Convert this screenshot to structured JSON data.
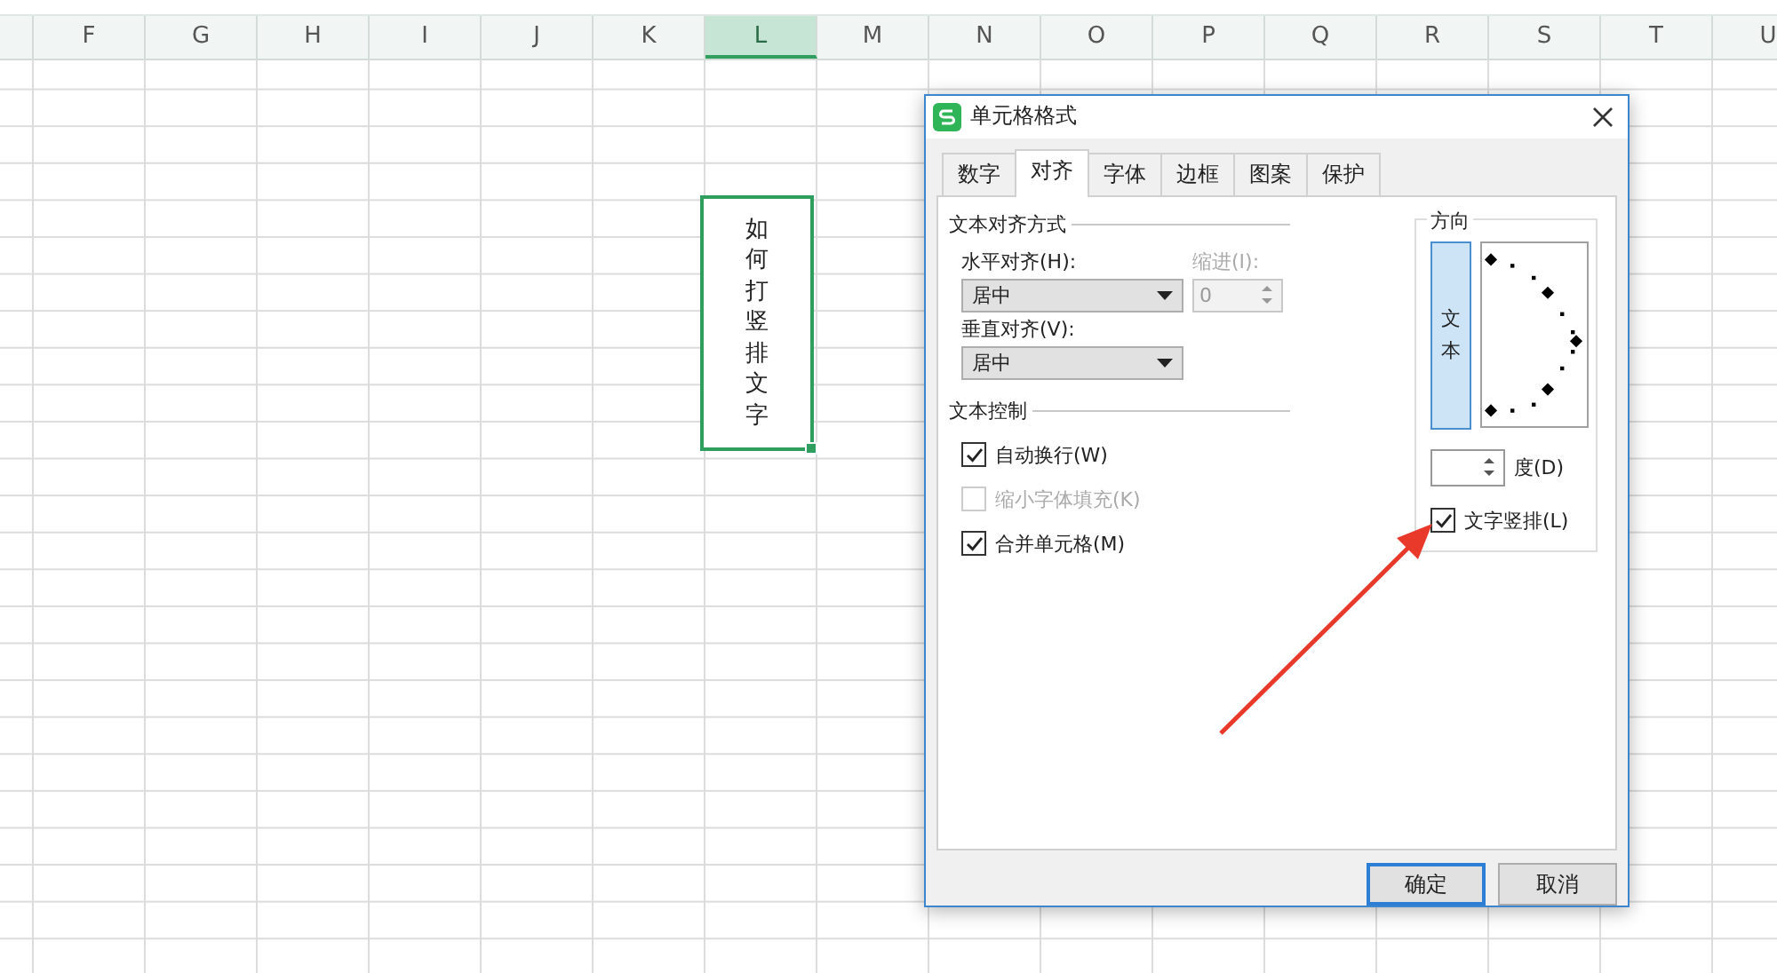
{
  "sheet": {
    "columns": [
      {
        "label": "F",
        "selected": false
      },
      {
        "label": "G",
        "selected": false
      },
      {
        "label": "H",
        "selected": false
      },
      {
        "label": "I",
        "selected": false
      },
      {
        "label": "J",
        "selected": false
      },
      {
        "label": "K",
        "selected": false
      },
      {
        "label": "L",
        "selected": true
      },
      {
        "label": "M",
        "selected": false
      },
      {
        "label": "N",
        "selected": false
      },
      {
        "label": "O",
        "selected": false
      },
      {
        "label": "P",
        "selected": false
      },
      {
        "label": "Q",
        "selected": false
      },
      {
        "label": "R",
        "selected": false
      },
      {
        "label": "S",
        "selected": false
      },
      {
        "label": "T",
        "selected": false
      },
      {
        "label": "U",
        "selected": false
      }
    ],
    "merged_cell": {
      "text": "如何打竖排文字"
    }
  },
  "dialog": {
    "title": "单元格格式",
    "tabs": [
      {
        "label": "数字",
        "selected": false
      },
      {
        "label": "对齐",
        "selected": true
      },
      {
        "label": "字体",
        "selected": false
      },
      {
        "label": "边框",
        "selected": false
      },
      {
        "label": "图案",
        "selected": false
      },
      {
        "label": "保护",
        "selected": false
      }
    ],
    "alignment": {
      "title": "文本对齐方式",
      "horizontal": {
        "label": "水平对齐(H):",
        "value": "居中"
      },
      "indent": {
        "label": "缩进(I):",
        "value": "0",
        "disabled": true
      },
      "vertical": {
        "label": "垂直对齐(V):",
        "value": "居中"
      }
    },
    "text_control": {
      "title": "文本控制",
      "options": [
        {
          "label": "自动换行(W)",
          "checked": true,
          "disabled": false
        },
        {
          "label": "缩小字体填充(K)",
          "checked": false,
          "disabled": true
        },
        {
          "label": "合并单元格(M)",
          "checked": true,
          "disabled": false
        }
      ]
    },
    "orientation": {
      "title": "方向",
      "vertical_text": "文本",
      "degrees_label": "度(D)",
      "vertical_option": {
        "label": "文字竖排(L)",
        "checked": true,
        "disabled": false
      }
    },
    "buttons": [
      {
        "label": "确定",
        "default": true
      },
      {
        "label": "取消",
        "default": false
      }
    ]
  }
}
